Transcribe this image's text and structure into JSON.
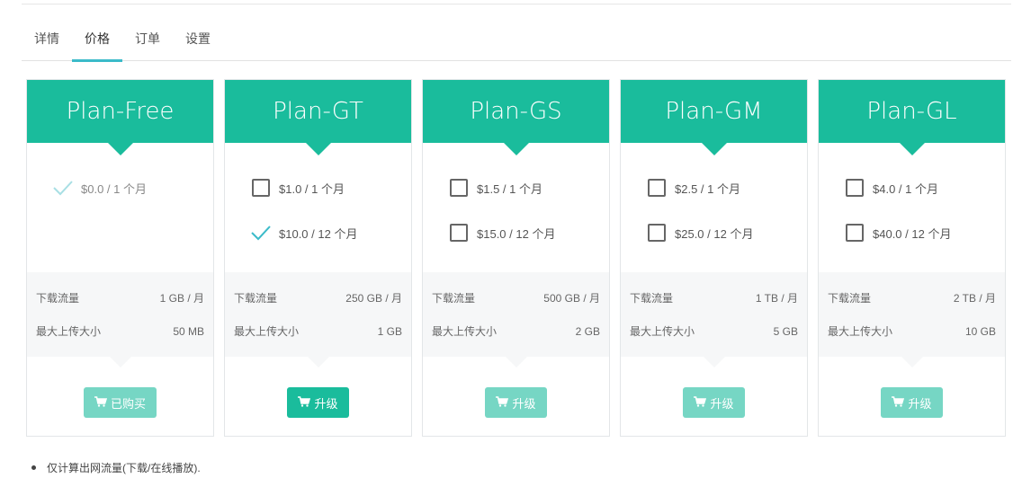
{
  "tabs": [
    {
      "label": "详情",
      "active": false
    },
    {
      "label": "价格",
      "active": true
    },
    {
      "label": "订单",
      "active": false
    },
    {
      "label": "设置",
      "active": false
    }
  ],
  "labels": {
    "download": "下载流量",
    "upload": "最大上传大小"
  },
  "plans": [
    {
      "name": "Plan-Free",
      "options": [
        {
          "price": "$0.0 / 1 个月",
          "selected": true
        }
      ],
      "download": "1 GB / 月",
      "upload": "50 MB",
      "button": "已购买",
      "button_enabled": false
    },
    {
      "name": "Plan-GT",
      "options": [
        {
          "price": "$1.0 / 1 个月",
          "selected": false
        },
        {
          "price": "$10.0 / 12 个月",
          "selected": true
        }
      ],
      "download": "250 GB / 月",
      "upload": "1 GB",
      "button": "升级",
      "button_enabled": true
    },
    {
      "name": "Plan-GS",
      "options": [
        {
          "price": "$1.5 / 1 个月",
          "selected": false
        },
        {
          "price": "$15.0 / 12 个月",
          "selected": false
        }
      ],
      "download": "500 GB / 月",
      "upload": "2 GB",
      "button": "升级",
      "button_enabled": false
    },
    {
      "name": "Plan-GM",
      "options": [
        {
          "price": "$2.5 / 1 个月",
          "selected": false
        },
        {
          "price": "$25.0 / 12 个月",
          "selected": false
        }
      ],
      "download": "1 TB / 月",
      "upload": "5 GB",
      "button": "升级",
      "button_enabled": false
    },
    {
      "name": "Plan-GL",
      "options": [
        {
          "price": "$4.0 / 1 个月",
          "selected": false
        },
        {
          "price": "$40.0 / 12 个月",
          "selected": false
        }
      ],
      "download": "2 TB / 月",
      "upload": "10 GB",
      "button": "升级",
      "button_enabled": false
    }
  ],
  "note": "仅计算出网流量(下载/在线播放).",
  "colors": {
    "accent": "#1abc9c",
    "accent_disabled": "#76d6c4",
    "tab_underline": "#3bbbc9",
    "check": "#3bbbc9"
  },
  "icons": {
    "cart": "shopping-cart-icon",
    "check": "check-icon",
    "checkbox": "checkbox-icon"
  }
}
